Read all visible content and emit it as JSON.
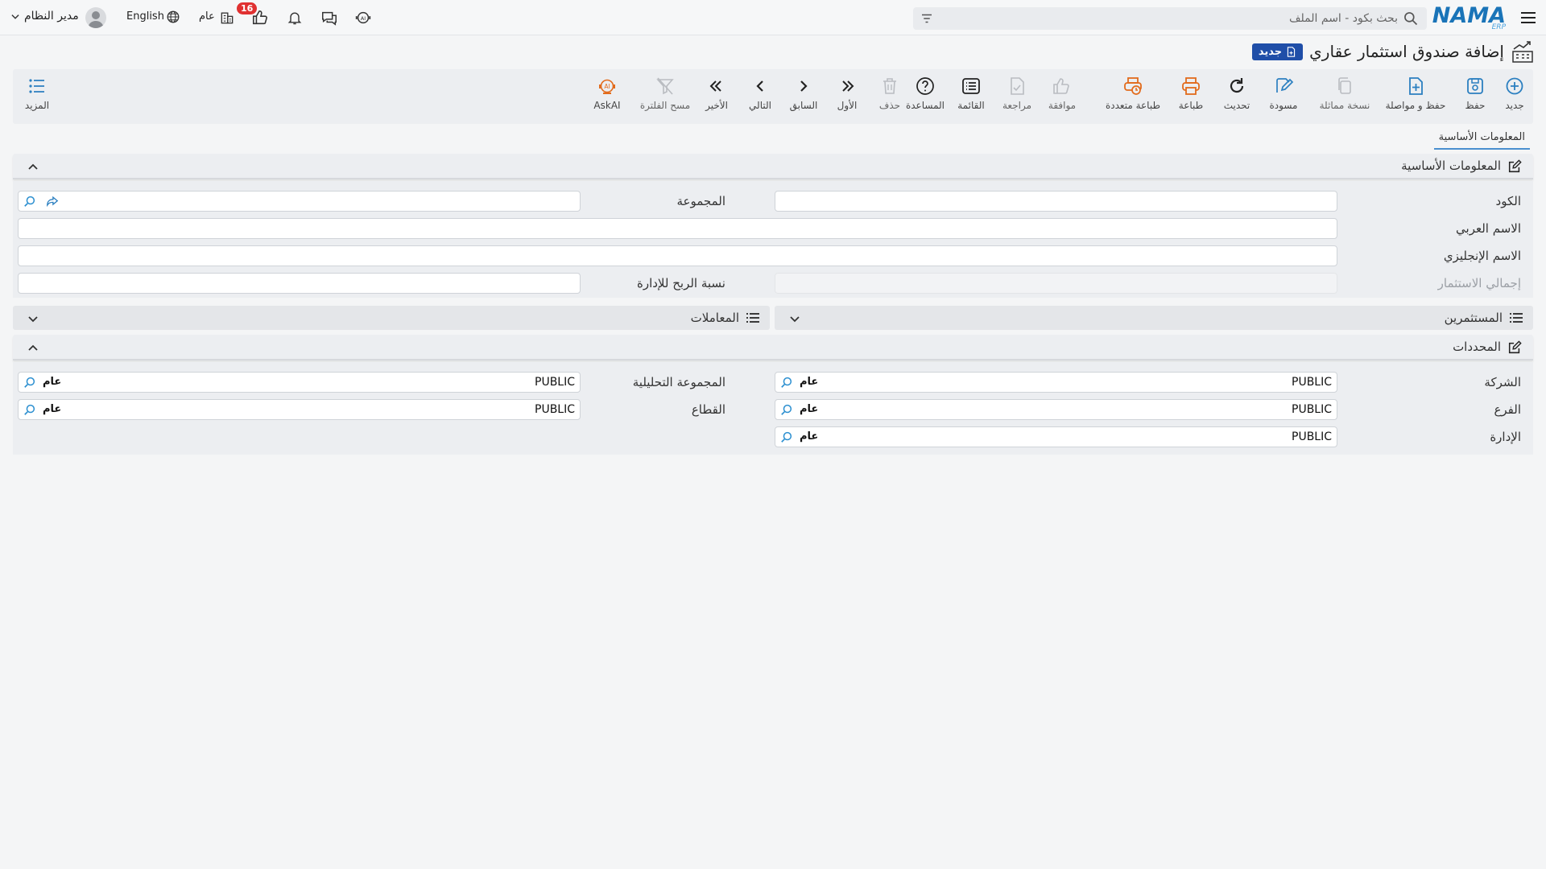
{
  "topbar": {
    "logo_text": "NAMA",
    "logo_sub": "ERP",
    "search_placeholder": "بحث بكود - اسم الملف",
    "user_name": "مدير النظام",
    "language": "English",
    "building_label": "عام",
    "likes_badge": "16",
    "brand_color": "#1a74b8"
  },
  "title": {
    "text": "إضافة صندوق استثمار عقاري",
    "badge": "جديد"
  },
  "toolbar": {
    "items": [
      {
        "label": "جديد",
        "icon": "plus-circle-icon"
      },
      {
        "label": "حفظ",
        "icon": "save-icon"
      },
      {
        "label": "حفظ و مواصلة",
        "icon": "save-continue-icon"
      },
      {
        "label": "نسخة مماثلة",
        "icon": "copy-icon"
      },
      {
        "label": "مسودة",
        "icon": "draft-icon"
      },
      {
        "label": "تحديث",
        "icon": "refresh-icon"
      },
      {
        "label": "طباعة",
        "icon": "print-icon"
      },
      {
        "label": "طباعة متعددة",
        "icon": "multi-print-icon"
      },
      {
        "label": "موافقة",
        "icon": "approve-icon"
      },
      {
        "label": "مراجعة",
        "icon": "review-icon"
      },
      {
        "label": "القائمة",
        "icon": "list-icon"
      },
      {
        "label": "المساعدة",
        "icon": "help-icon"
      },
      {
        "label": "حذف",
        "icon": "trash-icon"
      },
      {
        "label": "الأول",
        "icon": "first-icon"
      },
      {
        "label": "السابق",
        "icon": "previous-icon"
      },
      {
        "label": "التالي",
        "icon": "next-icon"
      },
      {
        "label": "الأخير",
        "icon": "last-icon"
      },
      {
        "label": "مسح الفلترة",
        "icon": "clear-filter-icon"
      },
      {
        "label": "AskAI",
        "icon": "ask-ai-icon"
      }
    ],
    "more_label": "المزيد"
  },
  "tabs": {
    "basic_info": "المعلومات الأساسية"
  },
  "basic_section": {
    "title": "المعلومات الأساسية",
    "fields": {
      "code_label": "الكود",
      "group_label": "المجموعة",
      "arabic_name_label": "الاسم العربي",
      "english_name_label": "الاسم الإنجليزي",
      "total_investment_label": "إجمالي الاستثمار",
      "mgmt_profit_label": "نسبة الربح للإدارة"
    }
  },
  "subsections": {
    "investors": "المستثمرين",
    "transactions": "المعاملات"
  },
  "dimensions_section": {
    "title": "المحددات",
    "fields": {
      "company_label": "الشركة",
      "company_value": "PUBLIC",
      "company_tag": "عام",
      "branch_label": "الفرع",
      "branch_value": "PUBLIC",
      "branch_tag": "عام",
      "department_label": "الإدارة",
      "department_value": "PUBLIC",
      "department_tag": "عام",
      "analysis_group_label": "المجموعة التحليلية",
      "analysis_group_value": "PUBLIC",
      "analysis_group_tag": "عام",
      "sector_label": "القطاع",
      "sector_value": "PUBLIC",
      "sector_tag": "عام"
    }
  }
}
